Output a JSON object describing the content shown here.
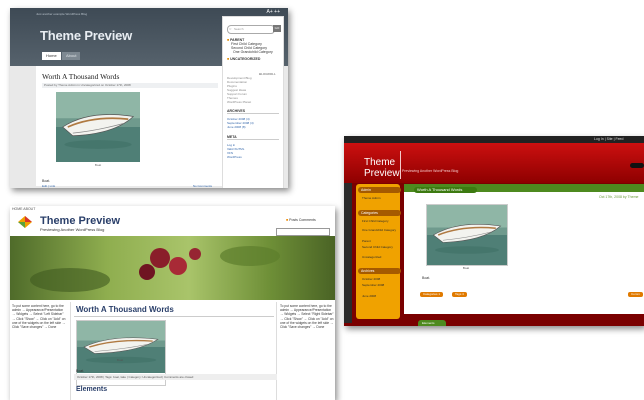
{
  "shot1": {
    "top_text": "Just another example WordPress Blog",
    "asp": "A+ ++",
    "title": "Theme Preview",
    "tabs": [
      "Home",
      "About"
    ],
    "post_title": "Worth A Thousand Words",
    "post_meta": "Posted by Theme Admin in Uncategorized on October 17th, 2008",
    "image_caption": "Boat",
    "boat_text": "Boat.",
    "link_left": "Edit | Link",
    "link_right": "No Comments",
    "search_placeholder": "Search",
    "search_button": "GO",
    "categories_head": "PARENT",
    "categories": [
      "First Child Category",
      "Second Child Category",
      "One Grandchild Category"
    ],
    "uncategorized_head": "UNCATEGORIZED",
    "blogroll_label": "BLOGROLL",
    "blogroll": [
      "Development Blog",
      "Documentation",
      "Plugins",
      "Suggest Ideas",
      "Support Forum",
      "Themes",
      "WordPress Planet"
    ],
    "archives_head": "ARCHIVES",
    "archives": [
      "October 2008 (4)",
      "September 2008 (4)",
      "June 2008 (8)"
    ],
    "meta_head": "META",
    "meta": [
      "Log in",
      "Valid XHTML",
      "XFN",
      "WordPress"
    ]
  },
  "shot2": {
    "topbar": "Log In | Site | Feed",
    "title_line1": "Theme",
    "title_line2": "Preview",
    "tagline": "Previewing Another WordPress Blog",
    "post_title": "Worth A Thousand Words",
    "date": "Oct 17th, 2008 by Theme",
    "caption": "Boat",
    "boat_text": "Boat.",
    "tags": [
      "Categories 1",
      "Tags 4"
    ],
    "comment_label": "Comm",
    "sidebar": {
      "admin_head": "Admin",
      "admin_items": [
        "Theme Admin"
      ],
      "categories_head": "Categories",
      "categories": [
        "First Child Category",
        "One Grandchild Category",
        "Parent",
        "Second Child Category",
        "Uncategorized"
      ],
      "archives_head": "Archives",
      "archives": [
        "October 2008",
        "September 2008",
        "June 2008"
      ]
    },
    "bottom_tab": "Elements"
  },
  "shot3": {
    "nav": "HOME  ABOUT",
    "title": "Theme Preview",
    "tagline": "Previewing Another WordPress Blog",
    "rss": "Posts  Comments",
    "left_text": "To put some content here, go to the admin → Appearance/Presentation → Widgets → Select \"Left Sidebar\" → Click \"Show\" → Click on \"Add\" on one of the widgets on the left side → Click \"Save changes\" → Done",
    "right_text": "To put some content here, go to the admin → Appearance/Presentation → Widgets → Select \"Right Sidebar\" → Click \"Show\" → Click on \"Add\" on one of the widgets on the left side → Click \"Save changes\" → Done",
    "post_title": "Worth A Thousand Words",
    "caption": "Boat",
    "boat_text": "Boat.",
    "meta_bar": "October 17th, 2008 | Tags: boat, lake | Category: Uncategorized | Comments are closed",
    "elements": "Elements"
  },
  "colors": {
    "shot1_header": "#4a5660",
    "shot2_red": "#cc1010",
    "shot2_orange": "#f0a200",
    "shot2_green": "#4d8a1f",
    "shot3_title": "#2a3f6a"
  }
}
